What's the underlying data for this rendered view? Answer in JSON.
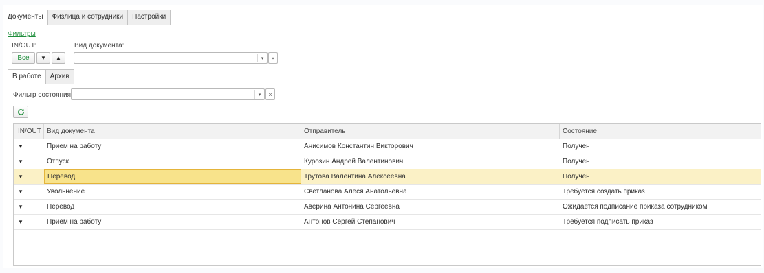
{
  "top_tabs": [
    {
      "label": "Документы",
      "active": true
    },
    {
      "label": "Физлица и сотрудники",
      "active": false
    },
    {
      "label": "Настройки",
      "active": false
    }
  ],
  "filters": {
    "link": "Фильтры",
    "inout_label": "IN/OUT:",
    "doc_type_label": "Вид документа:",
    "all_button": "Все",
    "down_arrow": "▼",
    "up_arrow": "▲",
    "doc_type_value": "",
    "dropdown_icon": "▾",
    "clear_icon": "×"
  },
  "sub_tabs": [
    {
      "label": "В работе",
      "active": true
    },
    {
      "label": "Архив",
      "active": false
    }
  ],
  "state_filter": {
    "label": "Фильтр состояния:",
    "value": ""
  },
  "refresh_icon": "refresh-icon",
  "colors": {
    "accent": "#1f8f3c",
    "selected_row": "#fbf1c6",
    "selected_cell": "#f8e38b"
  },
  "table": {
    "columns": [
      "IN/OUT",
      "Вид документа",
      "Отправитель",
      "Состояние"
    ],
    "rows": [
      {
        "dir": "▼",
        "doc": "Прием на работу",
        "sender": "Анисимов Константин Викторович",
        "state": "Получен"
      },
      {
        "dir": "▼",
        "doc": "Отпуск",
        "sender": "Курозин Андрей Валентинович",
        "state": "Получен"
      },
      {
        "dir": "▼",
        "doc": "Перевод",
        "sender": "Трутова Валентина Алексеевна",
        "state": "Получен",
        "selected": true
      },
      {
        "dir": "▼",
        "doc": "Увольнение",
        "sender": "Светланова Алеся Анатольевна",
        "state": "Требуется создать приказ"
      },
      {
        "dir": "▼",
        "doc": "Перевод",
        "sender": "Аверина Антонина Сергеевна",
        "state": "Ожидается подписание приказа сотрудником"
      },
      {
        "dir": "▼",
        "doc": "Прием на работу",
        "sender": "Антонов Сергей Степанович",
        "state": "Требуется подписать приказ"
      }
    ]
  }
}
